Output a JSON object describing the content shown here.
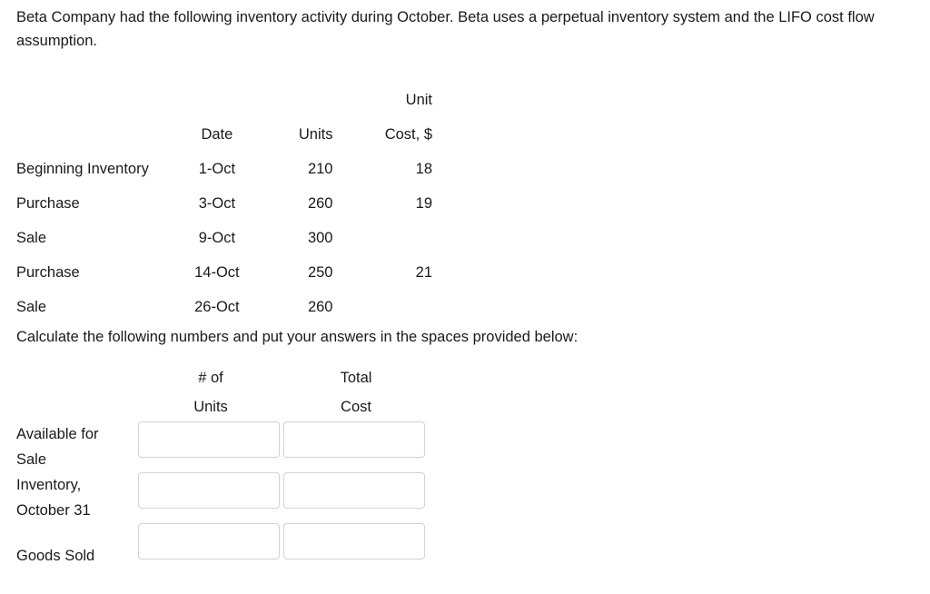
{
  "intro": {
    "text": "Beta Company had the following inventory activity during October. Beta uses a perpetual inventory system and the LIFO cost flow assumption."
  },
  "inventory_table": {
    "headers": {
      "label": "",
      "date": "Date",
      "units": "Units",
      "unit_cost_line1": "Unit",
      "unit_cost_line2": "Cost, $"
    },
    "rows": [
      {
        "label": "Beginning Inventory",
        "date": "1-Oct",
        "units": "210",
        "unit_cost": "18"
      },
      {
        "label": "Purchase",
        "date": "3-Oct",
        "units": "260",
        "unit_cost": "19"
      },
      {
        "label": "Sale",
        "date": "9-Oct",
        "units": "300",
        "unit_cost": ""
      },
      {
        "label": "Purchase",
        "date": "14-Oct",
        "units": "250",
        "unit_cost": "21"
      },
      {
        "label": "Sale",
        "date": "26-Oct",
        "units": "260",
        "unit_cost": ""
      }
    ]
  },
  "instruction": {
    "text": "Calculate the following numbers and put your answers in the spaces provided below:"
  },
  "answer_table": {
    "headers": {
      "units_line1": "# of",
      "units_line2": "Units",
      "cost_line1": "Total",
      "cost_line2": "Cost"
    },
    "rows": [
      {
        "label": "Available for\nSale",
        "units_value": "",
        "cost_value": ""
      },
      {
        "label": "Inventory,\nOctober 31",
        "units_value": "",
        "cost_value": ""
      },
      {
        "label": "Goods Sold",
        "units_value": "",
        "cost_value": ""
      }
    ]
  },
  "colors": {
    "text": "#1a1a1a",
    "background": "#ffffff",
    "input_border": "#d2d2d2"
  }
}
